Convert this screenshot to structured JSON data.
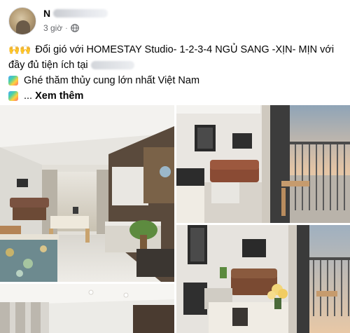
{
  "post": {
    "author_initial": "N",
    "time": "3 giờ",
    "separator": "·",
    "lines": [
      {
        "prefix": "🙌🙌",
        "text": "Đổi gió với HOMESTAY Studio- 1-2-3-4 NGỦ SANG -XỊN- MỊN với"
      },
      {
        "text": "đầy đủ tiện ích tại"
      },
      {
        "text": "Ghé thăm thủy cung lớn nhất Việt Nam"
      },
      {
        "text": "..."
      }
    ],
    "see_more": "Xem thêm"
  },
  "icons": {
    "privacy": "globe-icon",
    "sticker": "rainbow-sticker-icon",
    "hands": "raised-hands-icon"
  },
  "colors": {
    "text": "#050505",
    "meta": "#65676b",
    "wood": "#8a6a45",
    "sofa": "#7a4a32"
  }
}
